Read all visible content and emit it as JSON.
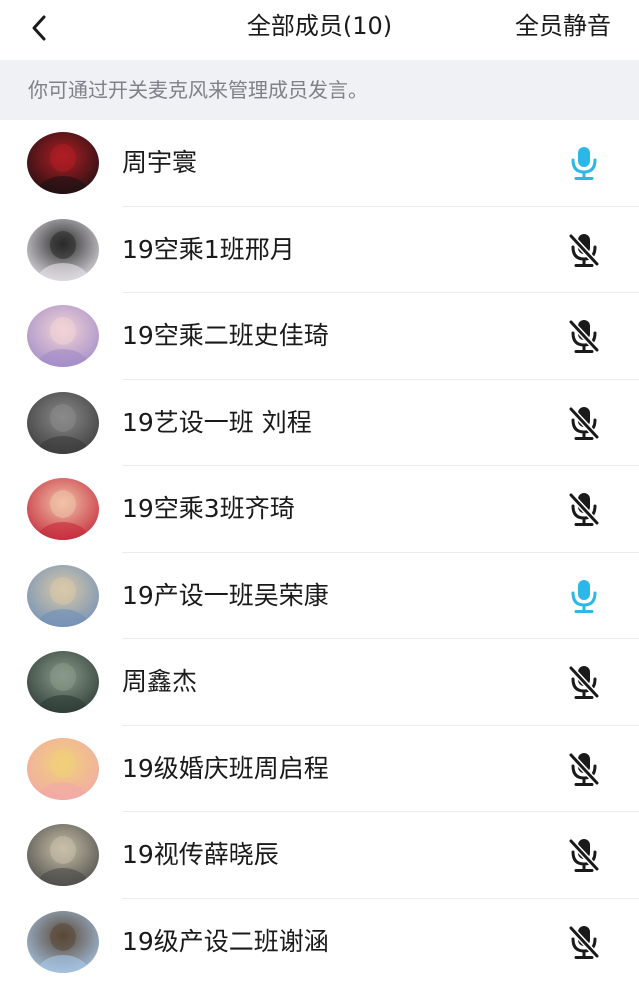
{
  "header": {
    "title": "全部成员(10)",
    "mute_all_label": "全员静音",
    "back_icon": "chevron-left-icon"
  },
  "tip": "你可通过开关麦克风来管理成员发言。",
  "colors": {
    "mic_on": "#2bb8e8",
    "mic_off": "#1a1a1a",
    "tip_bg": "#eff1f4",
    "tip_text": "#7d8189",
    "divider": "#ececec"
  },
  "members": [
    {
      "name": "周宇寰",
      "mic": "on",
      "avatar_colors": [
        "#1a1012",
        "#b01e24"
      ]
    },
    {
      "name": "19空乘1班邢月",
      "mic": "off",
      "avatar_colors": [
        "#e7e4ea",
        "#2a2a2a"
      ]
    },
    {
      "name": "19空乘二班史佳琦",
      "mic": "off",
      "avatar_colors": [
        "#a08bc8",
        "#f2d3d6"
      ]
    },
    {
      "name": "19艺设一班 刘程",
      "mic": "off",
      "avatar_colors": [
        "#3a3a3a",
        "#8a8a8a"
      ]
    },
    {
      "name": "19空乘3班齐琦",
      "mic": "off",
      "avatar_colors": [
        "#c4283a",
        "#f0c2a8"
      ]
    },
    {
      "name": "19产设一班吴荣康",
      "mic": "on",
      "avatar_colors": [
        "#6f8fb8",
        "#d9c9a8"
      ]
    },
    {
      "name": "周鑫杰",
      "mic": "off",
      "avatar_colors": [
        "#2b3a33",
        "#8a9a8a"
      ]
    },
    {
      "name": "19级婚庆班周启程",
      "mic": "off",
      "avatar_colors": [
        "#f2a8a8",
        "#f0d07a"
      ]
    },
    {
      "name": "19视传薛晓辰",
      "mic": "off",
      "avatar_colors": [
        "#4a4a48",
        "#c8bfa8"
      ]
    },
    {
      "name": "19级产设二班谢涵",
      "mic": "off",
      "avatar_colors": [
        "#a8c8e8",
        "#5a4838"
      ]
    }
  ]
}
